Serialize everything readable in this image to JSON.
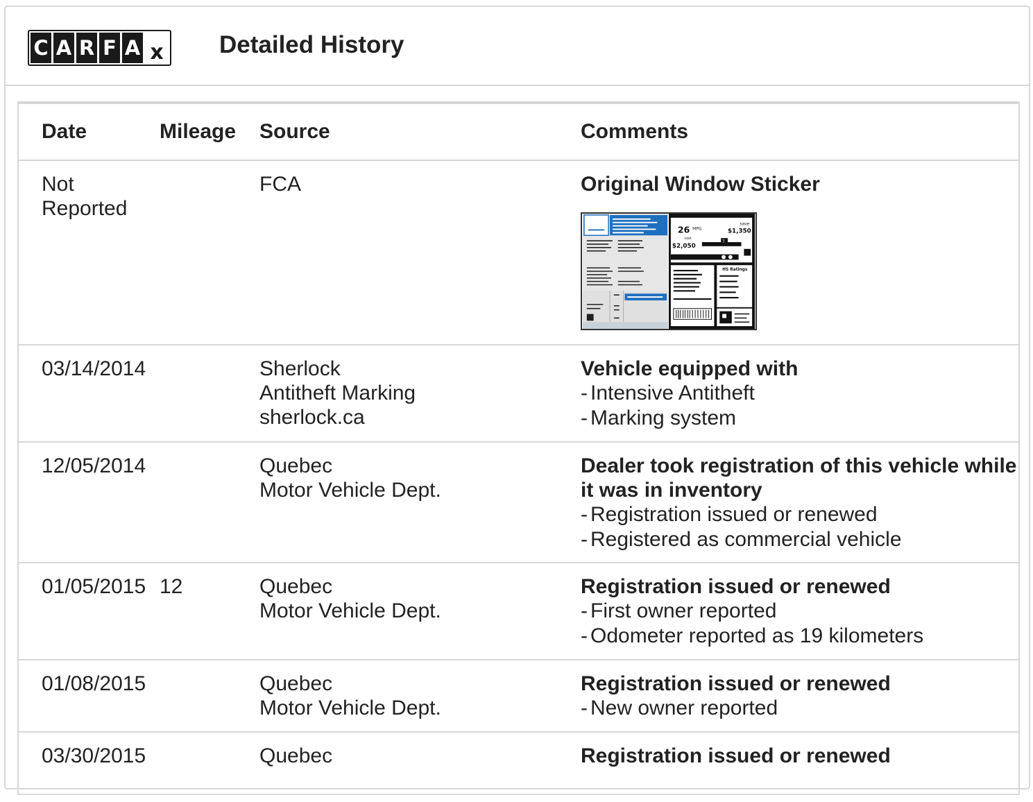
{
  "header": {
    "logo_letters": [
      "C",
      "A",
      "R",
      "F",
      "A"
    ],
    "logo_mark": "x",
    "title": "Detailed History"
  },
  "table": {
    "columns": [
      "Date",
      "Mileage",
      "Source",
      "Comments"
    ],
    "rows": [
      {
        "date": "Not Reported",
        "mileage": "",
        "source": [
          "FCA"
        ],
        "comment_title": "Original Window Sticker",
        "comment_items": [],
        "has_sticker": true
      },
      {
        "date": "03/14/2014",
        "mileage": "",
        "source": [
          "Sherlock",
          "Antitheft Marking",
          "sherlock.ca"
        ],
        "comment_title": "Vehicle equipped with",
        "comment_items": [
          "Intensive Antitheft",
          "Marking system"
        ]
      },
      {
        "date": "12/05/2014",
        "mileage": "",
        "source": [
          "Quebec",
          "Motor Vehicle Dept."
        ],
        "comment_title": "Dealer took registration of this vehicle while it was in inventory",
        "comment_items": [
          "Registration issued or renewed",
          "Registered as commercial vehicle"
        ]
      },
      {
        "date": "01/05/2015",
        "mileage": "12",
        "source": [
          "Quebec",
          "Motor Vehicle Dept."
        ],
        "comment_title": "Registration issued or renewed",
        "comment_items": [
          "First owner reported",
          "Odometer reported as 19 kilometers"
        ]
      },
      {
        "date": "01/08/2015",
        "mileage": "",
        "source": [
          "Quebec",
          "Motor Vehicle Dept."
        ],
        "comment_title": "Registration issued or renewed",
        "comment_items": [
          "New owner reported"
        ]
      },
      {
        "date": "03/30/2015",
        "mileage": "",
        "source": [
          "Quebec"
        ],
        "comment_title": "Registration issued or renewed",
        "comment_items": []
      }
    ]
  },
  "sticker": {
    "fuel_value": "26",
    "fuel_unit": "MPG",
    "save_label": "save",
    "save_value": "$1,350",
    "cost_label": "cost",
    "cost_value": "$2,050",
    "rating_value": "7",
    "safety_label": "HS Ratings"
  },
  "colors": {
    "border": "#d7d7d7",
    "text": "#222222",
    "sticker_blue": "#1f6fbf"
  }
}
